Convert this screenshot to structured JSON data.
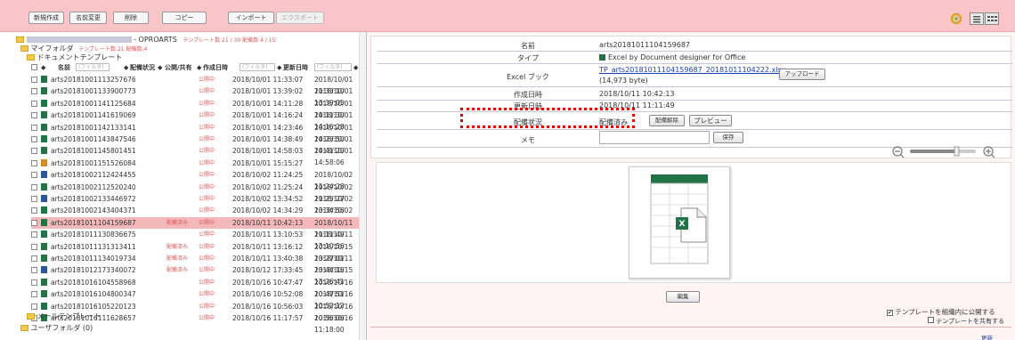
{
  "toolbar": {
    "buttons": [
      {
        "label": "新規作成"
      },
      {
        "label": "名前変更"
      },
      {
        "label": "削除"
      },
      {
        "label": "コピー"
      },
      {
        "label": "インポート"
      },
      {
        "label": "エクスポート"
      }
    ]
  },
  "tree": {
    "root_label": "- OPROARTS",
    "root_counts": "テンプレート数 21 / 30  配備数 4 / 15",
    "my_folder": "マイフォルダ",
    "my_folder_counts": "テンプレート数:21  配備数:4",
    "doc_templates": "ドキュメントテンプレート",
    "mail_templates": "メールテンプレート",
    "user_folder": "ユーザフォルダ (0)"
  },
  "grid": {
    "col_name": "名前",
    "col_status": "配備状況",
    "col_share": "公開/共有",
    "col_created": "作成日時",
    "col_updated": "更新日時",
    "filter_placeholder": "(フィルタ)",
    "rows": [
      {
        "name": "arts20181001113257676",
        "status": "",
        "share": "公開中",
        "created": "2018/10/01 11:33:07",
        "updated": "2018/10/01 11:33:10",
        "icon": "excel"
      },
      {
        "name": "arts20181001133900773",
        "status": "",
        "share": "公開中",
        "created": "2018/10/01 13:39:02",
        "updated": "2018/10/01 13:39:05",
        "icon": "excel"
      },
      {
        "name": "arts20181001141125684",
        "status": "",
        "share": "公開中",
        "created": "2018/10/01 14:11:28",
        "updated": "2018/10/01 14:11:30",
        "icon": "excel"
      },
      {
        "name": "arts20181001141619069",
        "status": "",
        "share": "公開中",
        "created": "2018/10/01 14:16:24",
        "updated": "2018/10/01 14:16:28",
        "icon": "excel"
      },
      {
        "name": "arts20181001142133141",
        "status": "",
        "share": "公開中",
        "created": "2018/10/01 14:23:46",
        "updated": "2018/10/01 14:23:50",
        "icon": "excel"
      },
      {
        "name": "arts20181001143847546",
        "status": "",
        "share": "公開中",
        "created": "2018/10/01 14:38:49",
        "updated": "2018/10/01 14:41:20",
        "icon": "excel"
      },
      {
        "name": "arts20181001145801451",
        "status": "",
        "share": "公開中",
        "created": "2018/10/01 14:58:03",
        "updated": "2018/10/01 14:58:06",
        "icon": "excel"
      },
      {
        "name": "arts20181001151526084",
        "status": "",
        "share": "公開中",
        "created": "2018/10/01 15:15:27",
        "updated": "",
        "icon": "other"
      },
      {
        "name": "arts20181002112424455",
        "status": "",
        "share": "公開中",
        "created": "2018/10/02 11:24:25",
        "updated": "2018/10/02 11:24:28",
        "icon": "word"
      },
      {
        "name": "arts20181002112520240",
        "status": "",
        "share": "公開中",
        "created": "2018/10/02 11:25:24",
        "updated": "2018/10/02 11:25:27",
        "icon": "excel"
      },
      {
        "name": "arts20181002133446972",
        "status": "",
        "share": "公開中",
        "created": "2018/10/02 13:34:52",
        "updated": "2018/10/02 13:34:56",
        "icon": "word"
      },
      {
        "name": "arts20181002143404371",
        "status": "",
        "share": "公開中",
        "created": "2018/10/02 14:34:29",
        "updated": "2018/10/02 14:34:33",
        "icon": "excel"
      },
      {
        "name": "arts20181011104159687",
        "status": "配備済み",
        "share": "公開中",
        "created": "2018/10/11 10:42:13",
        "updated": "2018/10/11 11:11:49",
        "icon": "excel",
        "selected": true
      },
      {
        "name": "arts20181011130836675",
        "status": "",
        "share": "公開中",
        "created": "2018/10/11 13:10:53",
        "updated": "2018/10/11 13:10:56",
        "icon": "excel"
      },
      {
        "name": "arts20181011131313411",
        "status": "配備済み",
        "share": "公開中",
        "created": "2018/10/11 13:16:12",
        "updated": "2018/10/15 13:27:01",
        "icon": "excel"
      },
      {
        "name": "arts20181011134019734",
        "status": "配備済み",
        "share": "公開中",
        "created": "2018/10/11 13:40:38",
        "updated": "2018/10/11 13:44:16",
        "icon": "excel"
      },
      {
        "name": "arts20181012173340072",
        "status": "配備済み",
        "share": "公開中",
        "created": "2018/10/12 17:33:45",
        "updated": "2018/10/15 13:26:41",
        "icon": "word"
      },
      {
        "name": "arts20181016104558968",
        "status": "",
        "share": "公開中",
        "created": "2018/10/16 10:47:47",
        "updated": "2018/10/16 10:47:51",
        "icon": "excel"
      },
      {
        "name": "arts20181016104800347",
        "status": "",
        "share": "公開中",
        "created": "2018/10/16 10:52:08",
        "updated": "2018/10/16 10:52:12",
        "icon": "excel"
      },
      {
        "name": "arts20181016105220123",
        "status": "",
        "share": "公開中",
        "created": "2018/10/16 10:56:03",
        "updated": "2018/10/16 10:56:06",
        "icon": "excel"
      },
      {
        "name": "arts20181016111628657",
        "status": "",
        "share": "公開中",
        "created": "2018/10/16 11:17:57",
        "updated": "2018/10/16 11:18:00",
        "icon": "excel"
      }
    ]
  },
  "detail": {
    "name_label": "名前",
    "name_value": "arts20181011104159687",
    "type_label": "タイプ",
    "type_value": "Excel by Document designer for Office",
    "book_label": "Excel ブック",
    "book_link": "TP_arts20181011104159687_20181011104222.xlsx",
    "book_size": "(14,973 byte)",
    "upload_label": "アップロード",
    "created_label": "作成日時",
    "created_value": "2018/10/11 10:42:13",
    "updated_label": "更新日時",
    "updated_value": "2018/10/11 11:11:49",
    "deploy_label": "配備状況",
    "deploy_value": "配備済み",
    "undeploy_label": "配備解除",
    "preview_label": "プレビュー",
    "memo_label": "メモ",
    "save_label": "保存",
    "edit_label": "編集",
    "publish_label": "テンプレートを組織内に公開する",
    "share_label": "テンプレートを共有する",
    "footer_link": "更新"
  },
  "colors": {
    "topbar": "#f9c5c8",
    "highlight": "#e00000",
    "selected_row": "#f4b8bb",
    "excel": "#217346",
    "word": "#2b579a"
  }
}
